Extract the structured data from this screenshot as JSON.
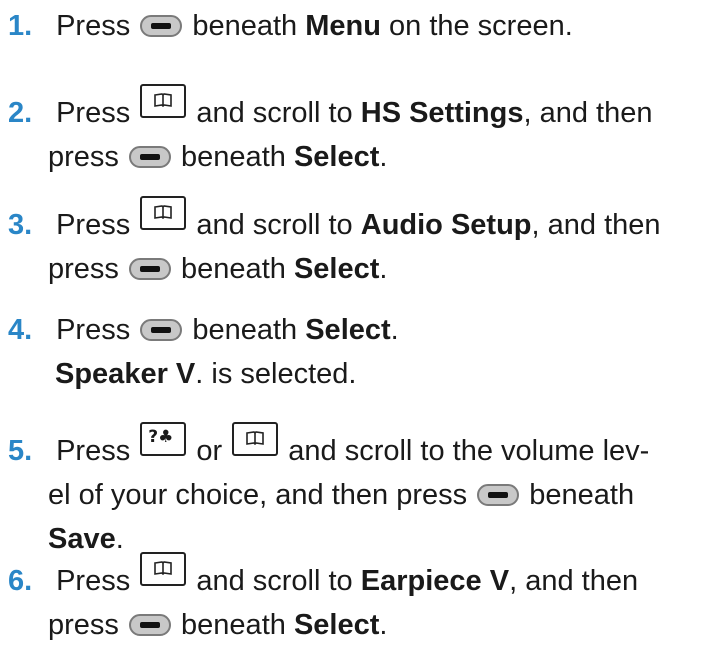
{
  "steps": [
    {
      "number": "1.",
      "lines": [
        {
          "a": "Press",
          "b": "beneath",
          "c": "Menu",
          "d": "on the screen."
        }
      ]
    },
    {
      "number": "2.",
      "l1": {
        "a": "Press",
        "b": "and scroll to",
        "c": "HS Settings",
        "d": ", and then"
      },
      "l2": {
        "a": "press",
        "b": "beneath",
        "c": "Select",
        "d": "."
      }
    },
    {
      "number": "3.",
      "l1": {
        "a": "Press",
        "b": "and scroll to",
        "c": "Audio Setup",
        "d": ", and then"
      },
      "l2": {
        "a": "press",
        "b": "beneath",
        "c": "Select",
        "d": "."
      }
    },
    {
      "number": "4.",
      "l1": {
        "a": "Press",
        "b": "beneath",
        "c": "Select",
        "d": "."
      },
      "l2": {
        "a": "Speaker V",
        "b": ". is selected."
      }
    },
    {
      "number": "5.",
      "l1": {
        "a": "Press",
        "b": "or",
        "c": "and scroll to the volume lev-"
      },
      "l2": {
        "a": "el of your choice, and then press",
        "b": "beneath"
      },
      "l3": {
        "a": "Save",
        "b": "."
      }
    },
    {
      "number": "6.",
      "l1": {
        "a": "Press",
        "b": "and scroll to",
        "c": "Earpiece V",
        "d": ", and then"
      },
      "l2": {
        "a": "press",
        "b": "beneath",
        "c": "Select",
        "d": "."
      }
    }
  ],
  "key_labels": {
    "intercom": "?♣"
  },
  "icons": [
    "softkey-icon",
    "phonebook-key-icon",
    "intercom-key-icon"
  ],
  "colors": {
    "step_number": "#2a86c7",
    "text": "#1a1a1a"
  }
}
